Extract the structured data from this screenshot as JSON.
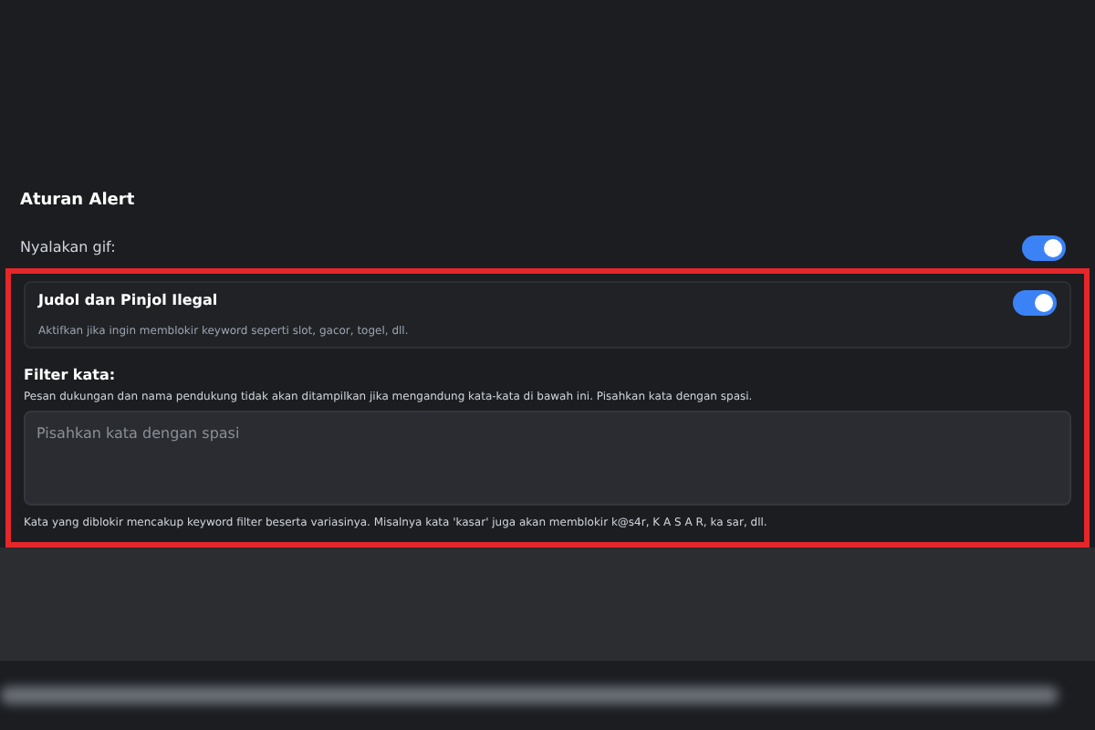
{
  "section": {
    "title": "Aturan Alert",
    "gif_toggle": {
      "label": "Nyalakan gif:",
      "on": true
    }
  },
  "highlight": {
    "card": {
      "title": "Judol dan Pinjol Ilegal",
      "description": "Aktifkan jika ingin memblokir keyword seperti slot, gacor, togel, dll.",
      "on": true
    },
    "filter": {
      "label": "Filter kata:",
      "description": "Pesan dukungan dan nama pendukung tidak akan ditampilkan jika mengandung kata-kata di bawah ini. Pisahkan kata dengan spasi.",
      "placeholder": "Pisahkan kata dengan spasi",
      "note": "Kata yang diblokir mencakup keyword filter beserta variasinya. Misalnya kata 'kasar' juga akan memblokir k@s4r, K A S A R, ka sar, dll."
    }
  }
}
